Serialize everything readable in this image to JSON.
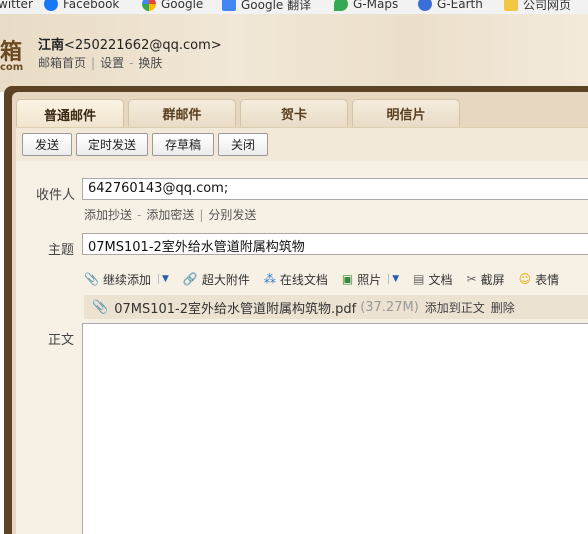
{
  "bookmarks": [
    {
      "label": "witter",
      "icon": "twitter-icon"
    },
    {
      "label": "Facebook",
      "icon": "facebook-icon"
    },
    {
      "label": "Google",
      "icon": "google-icon"
    },
    {
      "label": "Google 翻译",
      "icon": "google-translate-icon"
    },
    {
      "label": "G-Maps",
      "icon": "maps-pin-icon"
    },
    {
      "label": "G-Earth",
      "icon": "earth-icon"
    },
    {
      "label": "公司网页",
      "icon": "folder-icon"
    }
  ],
  "header": {
    "logo_char": "箱",
    "logo_com": "com",
    "user_name": "江南",
    "user_email": "<250221662@qq.com>",
    "links": [
      "邮箱首页",
      "设置",
      "换肤"
    ]
  },
  "tabs": [
    "普通邮件",
    "群邮件",
    "贺卡",
    "明信片"
  ],
  "toolbar": {
    "send": "发送",
    "scheduled_send": "定时发送",
    "save_draft": "存草稿",
    "close": "关闭"
  },
  "form": {
    "recipient_label": "收件人",
    "recipient_value": "642760143@qq.com;",
    "cc_links": [
      "添加抄送",
      "添加密送",
      "分别发送"
    ],
    "subject_label": "主题",
    "subject_value": "07MS101-2室外给水管道附属构筑物",
    "body_label": "正文"
  },
  "attach_tools": [
    {
      "label": "继续添加",
      "icon": "paperclip-icon",
      "dropdown": true
    },
    {
      "label": "超大附件",
      "icon": "big-attachment-icon",
      "dropdown": false
    },
    {
      "label": "在线文档",
      "icon": "online-doc-icon",
      "dropdown": false
    },
    {
      "label": "照片",
      "icon": "photo-icon",
      "dropdown": true
    },
    {
      "label": "文档",
      "icon": "document-icon",
      "dropdown": false
    },
    {
      "label": "截屏",
      "icon": "screenshot-icon",
      "dropdown": false
    },
    {
      "label": "表情",
      "icon": "emoji-icon",
      "dropdown": false
    }
  ],
  "attachment": {
    "filename": "07MS101-2室外给水管道附属构筑物.pdf",
    "size": "(37.27M)",
    "add_to_body": "添加到正文",
    "delete": "删除"
  }
}
